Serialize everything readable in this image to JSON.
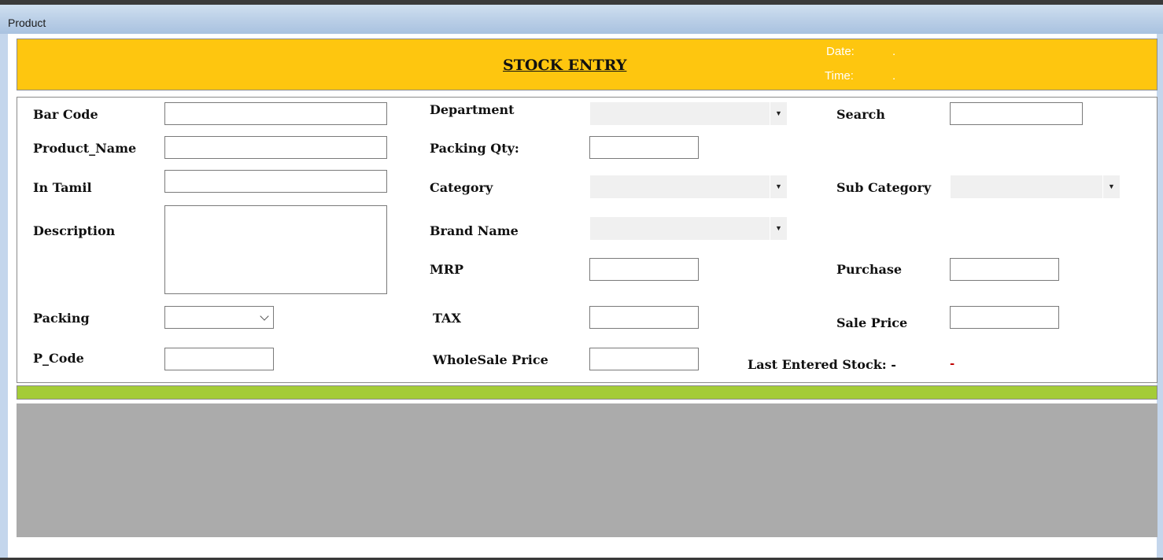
{
  "window": {
    "title": "Product"
  },
  "header": {
    "title": "STOCK ENTRY",
    "date_label": "Date:",
    "date_value": ".",
    "time_label": "Time:",
    "time_value": "."
  },
  "form": {
    "bar_code": {
      "label": "Bar Code",
      "value": ""
    },
    "product_name": {
      "label": "Product_Name",
      "value": ""
    },
    "in_tamil": {
      "label": "In Tamil",
      "value": ""
    },
    "description": {
      "label": "Description",
      "value": ""
    },
    "packing": {
      "label": "Packing",
      "selected": ""
    },
    "p_code": {
      "label": "P_Code",
      "value": ""
    },
    "department": {
      "label": "Department",
      "selected": ""
    },
    "packing_qty": {
      "label": "Packing Qty:",
      "value": ""
    },
    "category": {
      "label": "Category",
      "selected": ""
    },
    "brand_name": {
      "label": "Brand Name",
      "selected": ""
    },
    "mrp": {
      "label": "MRP",
      "value": ""
    },
    "tax": {
      "label": "TAX",
      "value": ""
    },
    "wholesale_price": {
      "label": "WholeSale Price",
      "value": ""
    },
    "search": {
      "label": "Search",
      "value": ""
    },
    "sub_category": {
      "label": "Sub Category",
      "selected": ""
    },
    "purchase": {
      "label": "Purchase",
      "value": ""
    },
    "sale_price": {
      "label": "Sale Price",
      "value": ""
    },
    "last_entered_stock": {
      "label": "Last Entered Stock: -",
      "value": "-"
    }
  },
  "icons": {
    "combo_arrow": "dropdown-arrow-icon",
    "select_chevron": "chevron-down-icon"
  },
  "colors": {
    "header_bg": "#fec60f",
    "status_bar": "#a4cc37",
    "grid_bg": "#ababab",
    "titlebar": "#b9cee6"
  }
}
